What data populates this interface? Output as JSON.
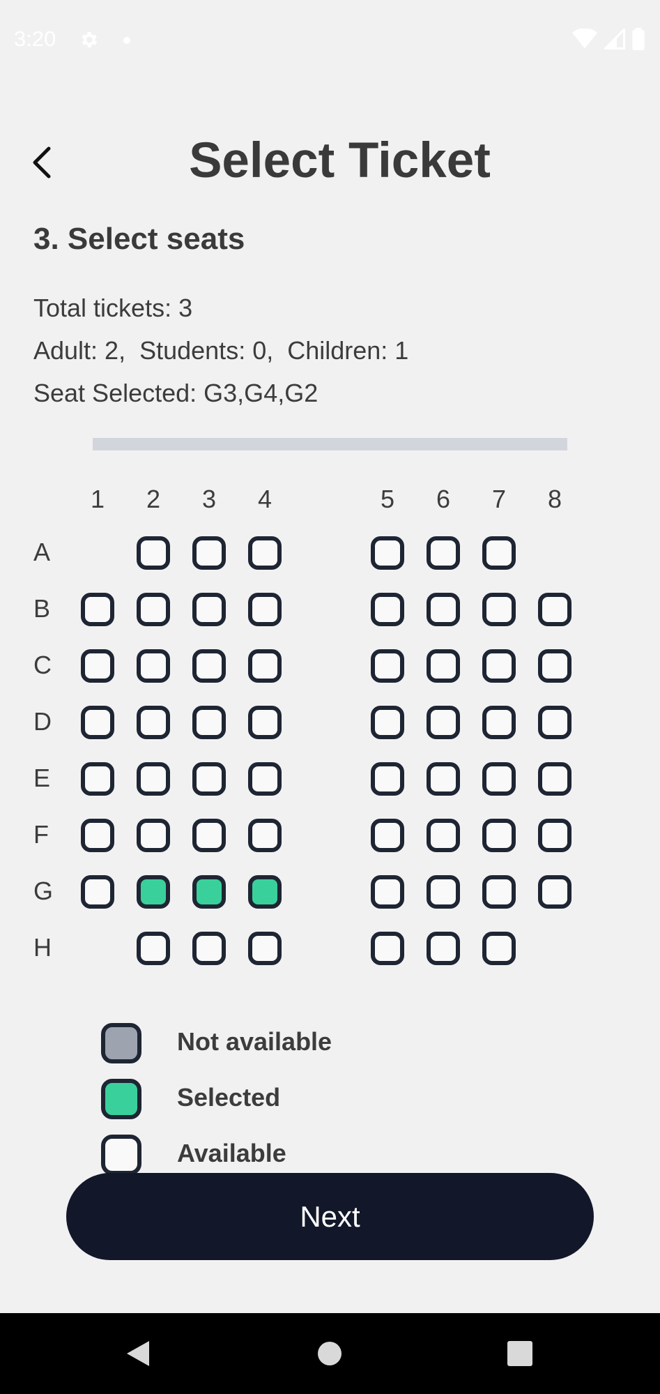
{
  "status_bar": {
    "time": "3:20"
  },
  "header": {
    "title": "Select Ticket"
  },
  "section": {
    "title": "3. Select seats"
  },
  "info": {
    "total": "Total tickets: 3",
    "breakdown": "Adult: 2,  Students: 0,  Children: 1",
    "selected": "Seat Selected: G3,G4,G2"
  },
  "columns": [
    "1",
    "2",
    "3",
    "4",
    "5",
    "6",
    "7",
    "8"
  ],
  "rows": [
    {
      "label": "A",
      "seats": [
        null,
        "available",
        "available",
        "available",
        "available",
        "available",
        "available",
        null
      ]
    },
    {
      "label": "B",
      "seats": [
        "available",
        "available",
        "available",
        "available",
        "available",
        "available",
        "available",
        "available"
      ]
    },
    {
      "label": "C",
      "seats": [
        "available",
        "available",
        "available",
        "available",
        "available",
        "available",
        "available",
        "available"
      ]
    },
    {
      "label": "D",
      "seats": [
        "available",
        "available",
        "available",
        "available",
        "available",
        "available",
        "available",
        "available"
      ]
    },
    {
      "label": "E",
      "seats": [
        "available",
        "available",
        "available",
        "available",
        "available",
        "available",
        "available",
        "available"
      ]
    },
    {
      "label": "F",
      "seats": [
        "available",
        "available",
        "available",
        "available",
        "available",
        "available",
        "available",
        "available"
      ]
    },
    {
      "label": "G",
      "seats": [
        "available",
        "selected",
        "selected",
        "selected",
        "available",
        "available",
        "available",
        "available"
      ]
    },
    {
      "label": "H",
      "seats": [
        null,
        "available",
        "available",
        "available",
        "available",
        "available",
        "available",
        null
      ]
    }
  ],
  "legend": {
    "not_available": "Not available",
    "selected": "Selected",
    "available": "Available"
  },
  "next_button": {
    "label": "Next"
  },
  "colors": {
    "selected": "#3ad09b",
    "not_available": "#9da3af",
    "available": "#faf9fa",
    "seat_border": "#1e2533",
    "button": "#121829"
  },
  "icons": {
    "back": "chevron-left-icon",
    "settings": "gear-icon",
    "wifi": "wifi-icon",
    "signal": "signal-icon",
    "battery": "battery-icon",
    "nav_back": "triangle-back-icon",
    "nav_home": "circle-home-icon",
    "nav_recents": "square-recents-icon"
  }
}
